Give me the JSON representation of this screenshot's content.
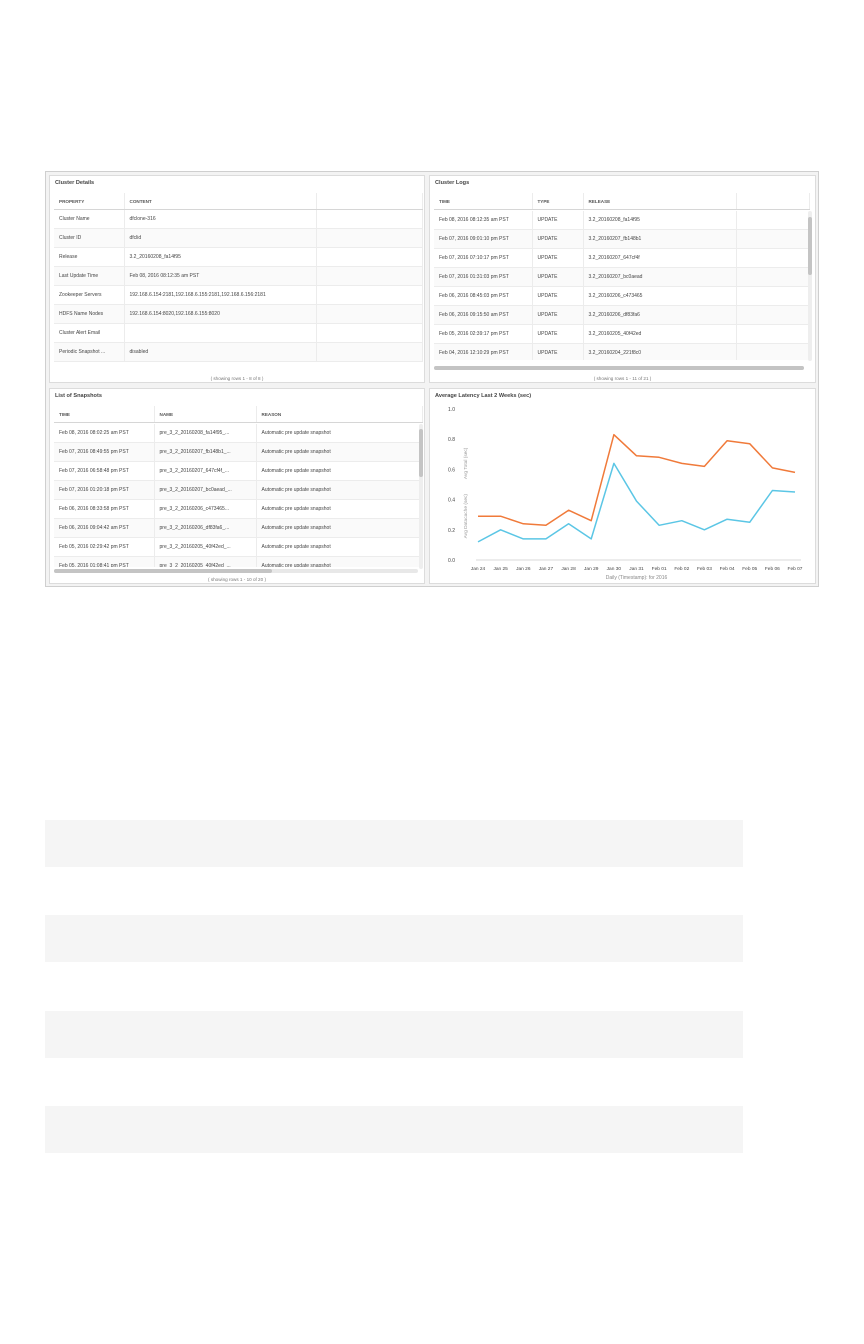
{
  "cluster_details": {
    "title": "Cluster Details",
    "columns": [
      "PROPERTY",
      "CONTENT"
    ],
    "rows": [
      [
        "Cluster Name",
        "dfclone-316"
      ],
      [
        "Cluster ID",
        "dfclid"
      ],
      [
        "Release",
        "3.2_20160208_fa14f95"
      ],
      [
        "Last Update Time",
        "Feb 08, 2016 08:12:35 am PST"
      ],
      [
        "Zookeeper Servers",
        "192.168.6.154:2181,192.168.6.155:2181,192.168.6.156:2181"
      ],
      [
        "HDFS Name Nodes",
        "192.168.6.154:8020,192.168.6.155:8020"
      ],
      [
        "Cluster Alert Email",
        ""
      ],
      [
        "Periodic Snapshot ...",
        "disabled"
      ]
    ],
    "footer": "( showing rows 1 - 8 of 8 )"
  },
  "cluster_logs": {
    "title": "Cluster Logs",
    "columns": [
      "TIME",
      "TYPE",
      "RELEASE"
    ],
    "rows": [
      [
        "Feb 08, 2016 08:12:35 am PST",
        "UPDATE",
        "3.2_20160208_fa14f95"
      ],
      [
        "Feb 07, 2016 09:01:10 pm PST",
        "UPDATE",
        "3.2_20160207_fb148b1"
      ],
      [
        "Feb 07, 2016 07:10:17 pm PST",
        "UPDATE",
        "3.2_20160207_647cf4f"
      ],
      [
        "Feb 07, 2016 01:31:03 pm PST",
        "UPDATE",
        "3.2_20160207_bc0aead"
      ],
      [
        "Feb 06, 2016 08:45:03 pm PST",
        "UPDATE",
        "3.2_20160206_c473465"
      ],
      [
        "Feb 06, 2016 09:15:50 am PST",
        "UPDATE",
        "3.2_20160206_df83fa6"
      ],
      [
        "Feb 05, 2016 02:39:17 pm PST",
        "UPDATE",
        "3.2_20160205_40f42ed"
      ],
      [
        "Feb 04, 2016 12:10:29 pm PST",
        "UPDATE",
        "3.2_20160204_221f8c0"
      ]
    ],
    "footer": "( showing rows 1 - 11 of 21 )"
  },
  "snapshots": {
    "title": "List of Snapshots",
    "columns": [
      "TIME",
      "NAME",
      "REASON"
    ],
    "rows": [
      [
        "Feb 08, 2016 08:02:25 am PST",
        "pre_3_2_20160208_fa14f95_...",
        "Automatic pre update snapshot"
      ],
      [
        "Feb 07, 2016 08:49:55 pm PST",
        "pre_3_2_20160207_fb148b1_...",
        "Automatic pre update snapshot"
      ],
      [
        "Feb 07, 2016 06:58:48 pm PST",
        "pre_3_2_20160207_647cf4f_...",
        "Automatic pre update snapshot"
      ],
      [
        "Feb 07, 2016 01:20:18 pm PST",
        "pre_3_2_20160207_bc0aead_...",
        "Automatic pre update snapshot"
      ],
      [
        "Feb 06, 2016 08:33:58 pm PST",
        "pre_3_2_20160206_c473465...",
        "Automatic pre update snapshot"
      ],
      [
        "Feb 06, 2016 09:04:42 am PST",
        "pre_3_2_20160206_df83fa6_...",
        "Automatic pre update snapshot"
      ],
      [
        "Feb 05, 2016 02:29:42 pm PST",
        "pre_3_2_20160205_40f42ed_...",
        "Automatic pre update snapshot"
      ],
      [
        "Feb 05, 2016 01:08:41 pm PST",
        "pre_3_2_20160205_40f42ed_...",
        "Automatic pre update snapshot"
      ]
    ],
    "footer": "( showing rows 1 - 10 of 20 )"
  },
  "latency": {
    "title": "Average Latency Last 2 Weeks (sec)"
  },
  "chart_data": {
    "type": "line",
    "title": "Average Latency Last 2 Weeks (sec)",
    "xlabel": "Daily (Timestamp): for 2016",
    "ylabels": [
      "Avg Total (sec)",
      "Avg Datacache (sec)"
    ],
    "categories": [
      "Jan 24",
      "Jan 25",
      "Jan 26",
      "Jan 27",
      "Jan 28",
      "Jan 29",
      "Jan 30",
      "Jan 31",
      "Feb 01",
      "Feb 02",
      "Feb 03",
      "Feb 04",
      "Feb 05",
      "Feb 06",
      "Feb 07"
    ],
    "yticks": [
      "1.0",
      "0.8",
      "0.6",
      "0.4",
      "0.2",
      "0.0"
    ],
    "ylim": [
      0,
      1.0
    ],
    "grid": false,
    "series": [
      {
        "values": [
          0.29,
          0.29,
          0.24,
          0.23,
          0.33,
          0.26,
          0.83,
          0.69,
          0.68,
          0.64,
          0.62,
          0.79,
          0.77,
          0.61,
          0.58
        ],
        "color": "#f07a3a"
      },
      {
        "values": [
          0.12,
          0.2,
          0.14,
          0.14,
          0.24,
          0.14,
          0.64,
          0.39,
          0.23,
          0.26,
          0.2,
          0.27,
          0.25,
          0.46,
          0.45
        ],
        "color": "#5bc6e5"
      }
    ]
  }
}
